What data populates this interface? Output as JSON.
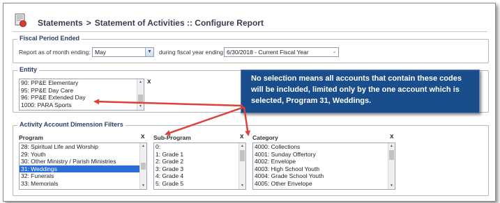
{
  "header": {
    "breadcrumb_root": "Statements",
    "separator": ">",
    "title": "Statement of Activities :: Configure Report"
  },
  "fiscal_period": {
    "legend": "Fiscal Period Ended",
    "month_label": "Report as of month ending:",
    "month_value": "May",
    "year_label": "during fiscal year ending:",
    "year_value": "6/30/2018 - Current Fiscal Year"
  },
  "entity": {
    "legend": "Entity",
    "clear": "x",
    "items": [
      "90: PP&E Elementary",
      "95: PP&E Day Care",
      "96: PP&E Extended Day",
      "1000: PARA Sports"
    ]
  },
  "dimension_filters": {
    "legend": "Activity Account Dimension Filters",
    "program": {
      "header": "Program",
      "clear": "x",
      "items": [
        "28: Spiritual Life and Worship",
        "29: Youth",
        "30: Other Ministry / Parish Ministries",
        "31: Weddings",
        "32: Funerals",
        "33: Memorials"
      ],
      "selected": "31: Weddings"
    },
    "sub_program": {
      "header": "Sub-Program",
      "clear": "x",
      "items": [
        "0:",
        "1: Grade 1",
        "2: Grade 2",
        "3: Grade 3",
        "4: Grade 4",
        "5: Grade 5"
      ]
    },
    "category": {
      "header": "Category",
      "clear": "x",
      "items": [
        "4000: Collections",
        "4001: Sunday Offertory",
        "4002: Envelope",
        "4003: High School Youth",
        "4004: Grade School Youth",
        "4005: Other Envelope"
      ]
    }
  },
  "callout": {
    "text": "No selection means all accounts that contain these codes will be included, limited only by the one account which is selected, Program 31, Weddings."
  },
  "colors": {
    "callout_bg": "#1a4d8c",
    "arrow": "#e0403a",
    "selection": "#2a6fd6",
    "legend_text": "#2d3f66"
  }
}
